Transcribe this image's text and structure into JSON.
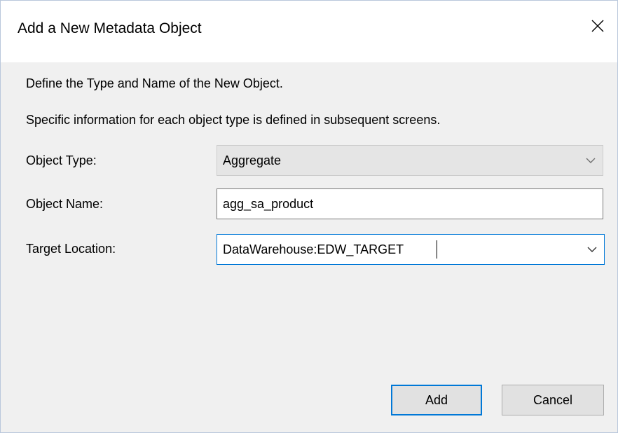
{
  "dialog": {
    "title": "Add a New Metadata Object",
    "intro_line1": "Define the Type and Name of the New Object.",
    "intro_line2": "Specific information for each object type is defined in subsequent screens."
  },
  "form": {
    "object_type": {
      "label": "Object Type:",
      "value": "Aggregate",
      "enabled": false
    },
    "object_name": {
      "label": "Object Name:",
      "value": "agg_sa_product"
    },
    "target_location": {
      "label": "Target Location:",
      "value": "DataWarehouse:EDW_TARGET",
      "focused": true
    }
  },
  "buttons": {
    "add_label": "Add",
    "cancel_label": "Cancel"
  },
  "icons": {
    "close": "close-icon",
    "dropdown": "chevron-down-icon"
  },
  "colors": {
    "accent": "#0078d7",
    "titlebar_bg": "#ffffff",
    "body_bg": "#f0f0f0",
    "disabled_field_bg": "#e5e5e5",
    "button_bg": "#e1e1e1"
  }
}
